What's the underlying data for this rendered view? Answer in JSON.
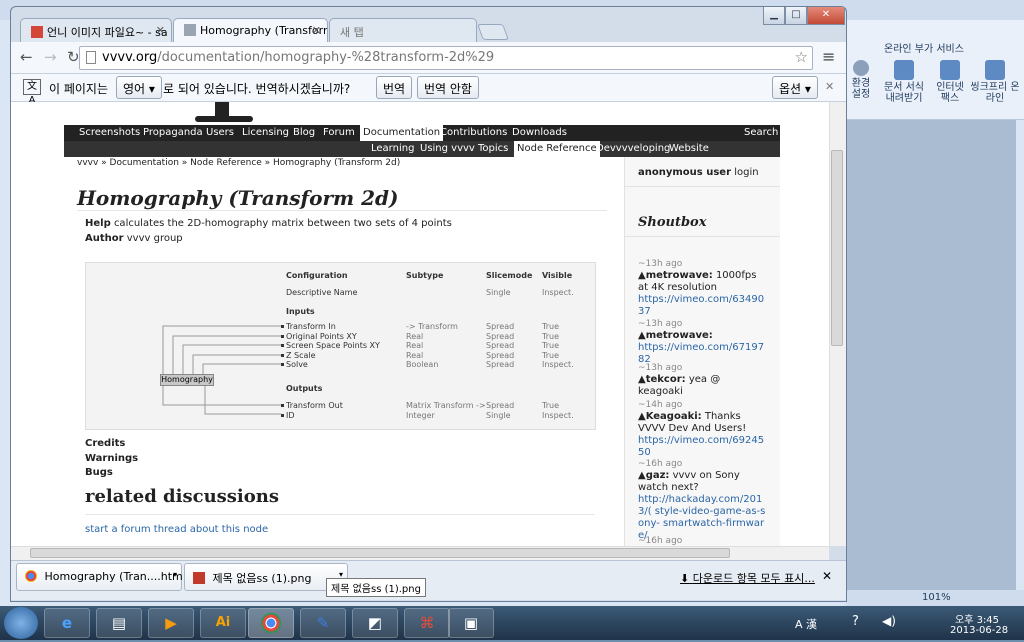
{
  "browser": {
    "caption": {
      "minimize": "▁",
      "maximize": "□",
      "close": "✕"
    },
    "tabs": [
      {
        "label": "언니 이미지 파일요~ - sa",
        "favicon_color": "#d44638"
      },
      {
        "label": "Homography (Transform",
        "favicon_color": "#9aa5b1"
      },
      {
        "label": "새 탭",
        "favicon_color": ""
      }
    ],
    "url_domain": "vvvv.org",
    "url_path": "/documentation/homography-%28transform-2d%29",
    "translate_bar": {
      "text_before": "이 페이지는",
      "language": "영어",
      "text_after": "로 되어 있습니다. 번역하시겠습니까?",
      "translate_button": "번역",
      "no_translate_button": "번역 안함",
      "options_button": "옵션"
    }
  },
  "page": {
    "menu_primary": [
      "Screenshots",
      "Propaganda",
      "Users",
      "Licensing",
      "Blog",
      "Forum",
      "Documentation",
      "Contributions",
      "Downloads",
      "Search"
    ],
    "menu_secondary": [
      "Learning",
      "Using vvvv",
      "Topics",
      "Node Reference",
      "Devvvveloping",
      "Website"
    ],
    "breadcrumb": "vvvv » Documentation » Node Reference » Homography (Transform 2d)",
    "title": "Homography (Transform 2d)",
    "help_label": "Help",
    "help_text": "calculates the 2D-homography matrix between two sets of 4 points",
    "author_label": "Author",
    "author_text": "vvvv group",
    "node": {
      "name": "Homography",
      "headers": [
        "Configuration",
        "Subtype",
        "Slicemode",
        "Visible"
      ],
      "config": {
        "name": "Descriptive Name",
        "subtype": "",
        "slice": "Single",
        "visible": "Inspect."
      },
      "inputs_label": "Inputs",
      "inputs": [
        {
          "name": "Transform In",
          "subtype": "-> Transform",
          "slice": "Spread",
          "visible": "True"
        },
        {
          "name": "Original Points XY",
          "subtype": "Real",
          "slice": "Spread",
          "visible": "True"
        },
        {
          "name": "Screen Space Points XY",
          "subtype": "Real",
          "slice": "Spread",
          "visible": "True"
        },
        {
          "name": "Z Scale",
          "subtype": "Real",
          "slice": "Spread",
          "visible": "True"
        },
        {
          "name": "Solve",
          "subtype": "Boolean",
          "slice": "Spread",
          "visible": "Inspect."
        }
      ],
      "outputs_label": "Outputs",
      "outputs": [
        {
          "name": "Transform Out",
          "subtype": "Matrix Transform ->",
          "slice": "Spread",
          "visible": "True"
        },
        {
          "name": "ID",
          "subtype": "Integer",
          "slice": "Single",
          "visible": "Inspect."
        }
      ]
    },
    "sections": [
      "Credits",
      "Warnings",
      "Bugs"
    ],
    "related_title": "related discussions",
    "forum_link": "start a forum thread about this node",
    "sidebar": {
      "user_bold": "anonymous user",
      "user_link": "login",
      "shoutbox_title": "Shoutbox",
      "shouts": [
        {
          "time": "~13h ago",
          "user": "metrowave:",
          "msg": "1000fps at 4K resolution",
          "link": "https://vimeo.com/6349037"
        },
        {
          "time": "~13h ago",
          "user": "metrowave:",
          "msg": "",
          "link": "https://vimeo.com/6719782"
        },
        {
          "time": "~13h ago",
          "user": "tekcor:",
          "msg": "yea @ keagoaki",
          "link": ""
        },
        {
          "time": "~14h ago",
          "user": "Keagoaki:",
          "msg": "Thanks VVVV Dev And Users!",
          "link": "https://vimeo.com/6924550"
        },
        {
          "time": "~16h ago",
          "user": "gaz:",
          "msg": "vvvv on Sony watch next?",
          "link": "http://hackaday.com/2013/( style-video-game-as-sony- smartwatch-firmware/"
        },
        {
          "time": "~16h ago",
          "user": "",
          "msg": "",
          "link": ""
        }
      ]
    }
  },
  "downloads": {
    "items": [
      "Homography (Tran....htm",
      "제목 없음ss (1).png"
    ],
    "tooltip": "제목 없음ss (1).png",
    "show_all": "다운로드 항목 모두 표시..."
  },
  "background_app": {
    "ribbon_group": "온라인 부가 서비스",
    "buttons": [
      "환경 설정",
      "문서 서식 내려받기",
      "인터넷 팩스",
      "씽크프리 온라인"
    ],
    "zoom": "101%"
  },
  "taskbar": {
    "apps": [
      "ie",
      "explorer",
      "media",
      "illustrator",
      "chrome",
      "hangul",
      "app",
      "acrobat",
      "paint"
    ],
    "lang": "A 漢",
    "time": "오후 3:45",
    "date": "2013-06-28"
  }
}
